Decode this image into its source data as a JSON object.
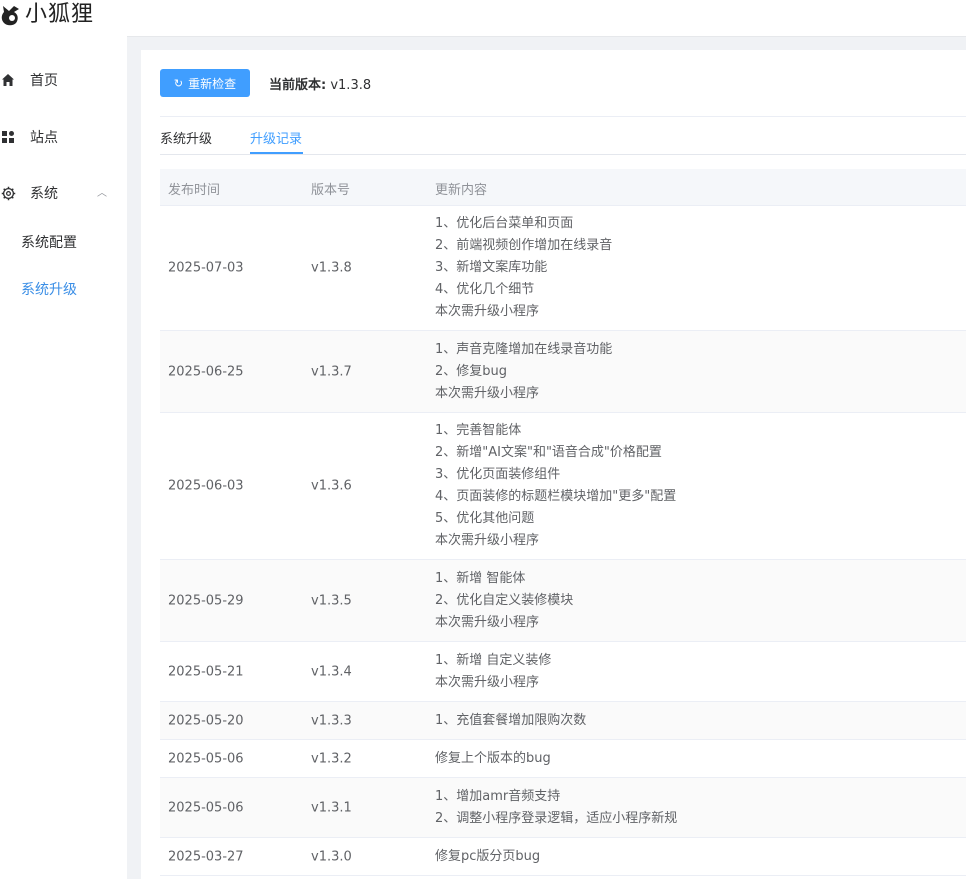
{
  "app": {
    "logo_text": "小狐狸"
  },
  "sidebar": {
    "items": [
      {
        "label": "首页",
        "icon": "home-icon"
      },
      {
        "label": "站点",
        "icon": "grid-icon"
      },
      {
        "label": "系统",
        "icon": "gear-icon"
      }
    ],
    "sub_items": [
      {
        "label": "系统配置"
      },
      {
        "label": "系统升级",
        "active": true
      }
    ]
  },
  "toolbar": {
    "refresh_label": "重新检查",
    "version_label": "当前版本:",
    "version_value": "v1.3.8"
  },
  "tabs": [
    {
      "label": "系统升级"
    },
    {
      "label": "升级记录",
      "active": true
    }
  ],
  "table": {
    "headers": [
      "发布时间",
      "版本号",
      "更新内容"
    ],
    "rows": [
      {
        "date": "2025-07-03",
        "version": "v1.3.8",
        "lines": [
          "1、优化后台菜单和页面",
          "2、前端视频创作增加在线录音",
          "3、新增文案库功能",
          "4、优化几个细节",
          "本次需升级小程序"
        ]
      },
      {
        "date": "2025-06-25",
        "version": "v1.3.7",
        "lines": [
          "1、声音克隆增加在线录音功能",
          "2、修复bug",
          "本次需升级小程序"
        ]
      },
      {
        "date": "2025-06-03",
        "version": "v1.3.6",
        "lines": [
          "1、完善智能体",
          "2、新增\"AI文案\"和\"语音合成\"价格配置",
          "3、优化页面装修组件",
          "4、页面装修的标题栏模块增加\"更多\"配置",
          "5、优化其他问题",
          "本次需升级小程序"
        ]
      },
      {
        "date": "2025-05-29",
        "version": "v1.3.5",
        "lines": [
          "1、新增 智能体",
          "2、优化自定义装修模块",
          "本次需升级小程序"
        ]
      },
      {
        "date": "2025-05-21",
        "version": "v1.3.4",
        "lines": [
          "1、新增 自定义装修",
          "本次需升级小程序"
        ]
      },
      {
        "date": "2025-05-20",
        "version": "v1.3.3",
        "lines": [
          "1、充值套餐增加限购次数"
        ]
      },
      {
        "date": "2025-05-06",
        "version": "v1.3.2",
        "lines": [
          "修复上个版本的bug"
        ]
      },
      {
        "date": "2025-05-06",
        "version": "v1.3.1",
        "lines": [
          "1、增加amr音频支持",
          "2、调整小程序登录逻辑，适应小程序新规"
        ]
      },
      {
        "date": "2025-03-27",
        "version": "v1.3.0",
        "lines": [
          "修复pc版分页bug"
        ]
      }
    ]
  },
  "colors": {
    "accent": "#409eff",
    "active_text": "#3a8ee6",
    "row_alt": "#fafafa",
    "page_bg": "#f0f2f5"
  }
}
